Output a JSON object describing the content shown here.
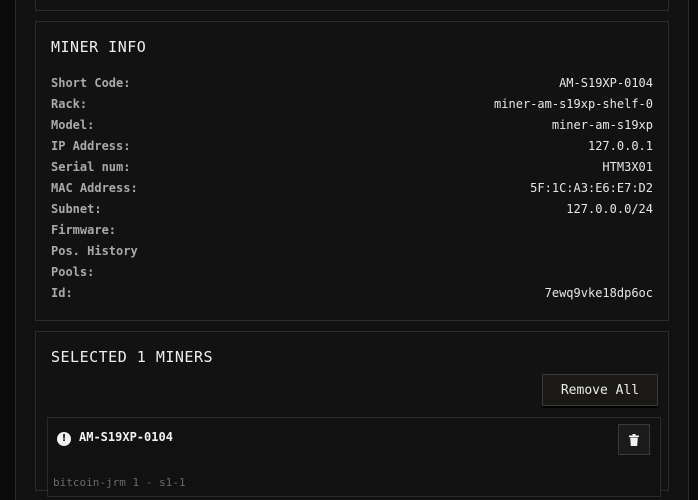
{
  "miner_info": {
    "title": "MINER INFO",
    "rows": [
      {
        "label": "Short Code:",
        "value": "AM-S19XP-0104"
      },
      {
        "label": "Rack:",
        "value": "miner-am-s19xp-shelf-0"
      },
      {
        "label": "Model:",
        "value": "miner-am-s19xp"
      },
      {
        "label": "IP Address:",
        "value": "127.0.0.1"
      },
      {
        "label": "Serial num:",
        "value": "HTM3X01"
      },
      {
        "label": "MAC Address:",
        "value": "5F:1C:A3:E6:E7:D2"
      },
      {
        "label": "Subnet:",
        "value": "127.0.0.0/24"
      },
      {
        "label": "Firmware:",
        "value": ""
      },
      {
        "label": "Pos. History",
        "value": ""
      },
      {
        "label": "Pools:",
        "value": ""
      },
      {
        "label": "Id:",
        "value": "7ewq9vke18dp6oc"
      }
    ]
  },
  "selected": {
    "title": "SELECTED 1 MINERS",
    "remove_all_label": "Remove All",
    "miners": [
      {
        "name": "AM-S19XP-0104",
        "status_icon": "alert-icon",
        "sub_text": "bitcoin-jrm 1 - s1-1"
      }
    ]
  },
  "colors": {
    "background": "#0b0b0b",
    "panel": "#121212",
    "border": "#2c2c2c",
    "label": "#a9a9a9",
    "value": "#e6e6e6"
  }
}
